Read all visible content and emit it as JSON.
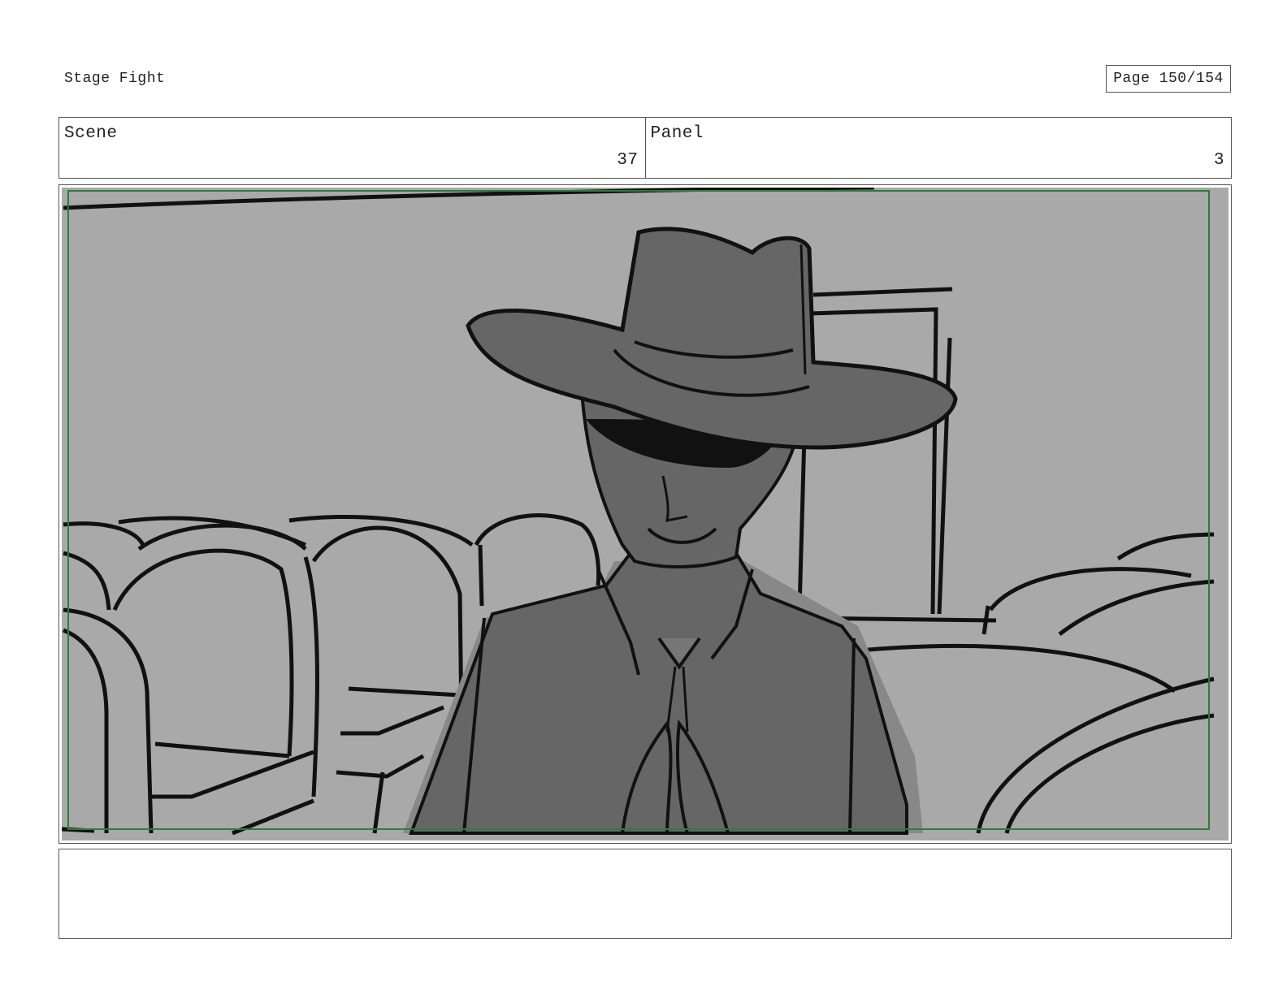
{
  "document": {
    "title": "Stage Fight",
    "page_label": "Page 150/154"
  },
  "header": {
    "scene_label": "Scene",
    "scene_number": "37",
    "panel_label": "Panel",
    "panel_number": "3"
  },
  "panel_image": {
    "subject": "figure-in-cowboy-hat-and-sunglasses",
    "colors": {
      "background": "#a9a9a9",
      "figure": "#666666",
      "shadow": "#888888",
      "lines": "#111111",
      "safe_frame": "#2e7d32"
    }
  },
  "notes": {
    "text": ""
  }
}
